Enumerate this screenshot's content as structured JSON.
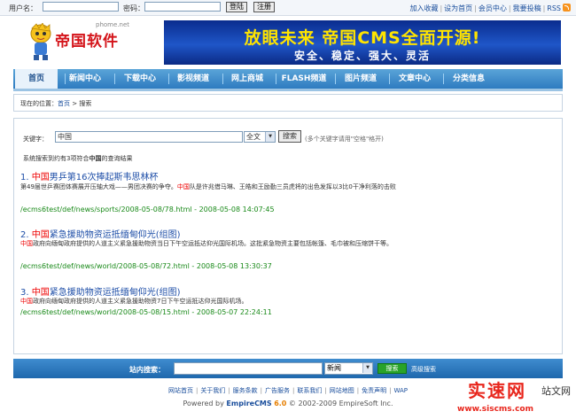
{
  "topbar": {
    "username_label": "用户名：",
    "password_label": "密码：",
    "login_button": "登陆",
    "register_button": "注册",
    "links": [
      "加入收藏",
      "设为首页",
      "会员中心",
      "我要投稿",
      "RSS"
    ]
  },
  "header": {
    "logo_text": "帝国软件",
    "logo_domain": "phome.net",
    "banner_title": "放眼未来 帝国CMS全面开源!",
    "banner_subtitle": "安全、稳定、强大、灵活"
  },
  "nav": {
    "items": [
      "首页",
      "新闻中心",
      "下载中心",
      "影视频道",
      "网上商城",
      "FLASH频道",
      "图片频道",
      "文章中心",
      "分类信息"
    ]
  },
  "breadcrumb": {
    "prefix": "现在的位置：",
    "home": "首页",
    "sep": " > ",
    "current": "搜索"
  },
  "search": {
    "keyword_label": "关键字：",
    "keyword_value": "中国",
    "scope_value": "全文",
    "button": "搜索",
    "tip": "(多个关键字请用\"空格\"格开)",
    "summary_prefix": "系统搜索到约有3项符合",
    "summary_keyword": "中国",
    "summary_suffix": "的查询结果"
  },
  "results": [
    {
      "num": "1.",
      "hl": "中国",
      "title_rest": "男乒第16次捧起斯韦思林杯",
      "desc_pre": "第49届世乒赛团体赛展开压轴大戏——男团决赛的争夺。",
      "desc_hl": "中国",
      "desc_rest": "队是许兆借马琳、王皓和王励勤三员虎将的出色发挥以3比0干净利落的击败",
      "url": "/ecms6test/def/news/sports/2008-05-08/78.html",
      "date": " - 2008-05-08 14:07:45"
    },
    {
      "num": "2.",
      "hl": "中国",
      "title_rest": "紧急援助物资运抵缅甸仰光(组图)",
      "desc_pre": "",
      "desc_hl": "中国",
      "desc_rest": "政府向缅甸政府提供的人道主义紧急援助物资当日下午空运抵达仰光国际机场。这批紧急物资主要包括帐篷、毛巾被和压缩饼干等。",
      "url": "/ecms6test/def/news/world/2008-05-08/72.html",
      "date": " - 2008-05-08 13:30:37"
    },
    {
      "num": "3.",
      "hl": "中国",
      "title_rest": "紧急援助物资运抵缅甸仰光(组图)",
      "desc_pre": "",
      "desc_hl": "中国",
      "desc_rest": "政府向缅甸政府提供的人道主义紧急援助物资7日下午空运抵达仰光国际机场。",
      "url": "/ecms6test/def/news/world/2008-05-08/15.html",
      "date": " - 2008-05-07 22:24:11"
    }
  ],
  "footer": {
    "search_label": "站内搜索：",
    "select_value": "新闻",
    "search_button": "搜索",
    "advanced": "高级搜索",
    "links": [
      "网站首页",
      "关于我们",
      "服务条款",
      "广告服务",
      "联系我们",
      "网站地图",
      "免责声明",
      "WAP"
    ],
    "powered_prefix": "Powered by ",
    "powered_brand": "EmpireCMS",
    "powered_version": "6.0",
    "powered_suffix": " © 2002-2009 EmpireSoft Inc."
  },
  "watermark": {
    "big": "实速网",
    "small": "站文网",
    "url": "www.siscms.com"
  },
  "colors": {
    "nav_blue": "#2e7bc0",
    "highlight_red": "#e00000",
    "url_green": "#1a8a1a",
    "link_blue": "#1a4e9c"
  }
}
